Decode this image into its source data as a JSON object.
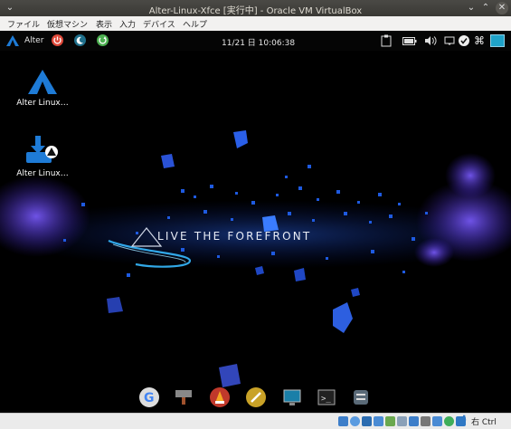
{
  "window": {
    "title": "Alter-Linux-Xfce [実行中] - Oracle VM VirtualBox"
  },
  "menu": [
    "ファイル",
    "仮想マシン",
    "表示",
    "入力",
    "デバイス",
    "ヘルプ"
  ],
  "panel": {
    "app_label": "Alter",
    "clock": "11/21 日 10:06:38"
  },
  "desktop": {
    "icons": [
      {
        "label": "Alter Linux…",
        "icon": "alter-logo-icon"
      },
      {
        "label": "Alter Linux…",
        "icon": "alter-installer-icon"
      }
    ],
    "wallpaper_text": "LIVE THE FOREFRONT"
  },
  "dock_icons": [
    "google-chrome-icon",
    "package-manager-icon",
    "media-player-icon",
    "text-editor-icon",
    "display-settings-icon",
    "terminal-icon",
    "system-settings-icon"
  ],
  "statusbar": {
    "host_key": "右 Ctrl"
  },
  "colors": {
    "accent_blue": "#1e7bd6",
    "power_red": "#e0493a",
    "green": "#4caf50"
  }
}
